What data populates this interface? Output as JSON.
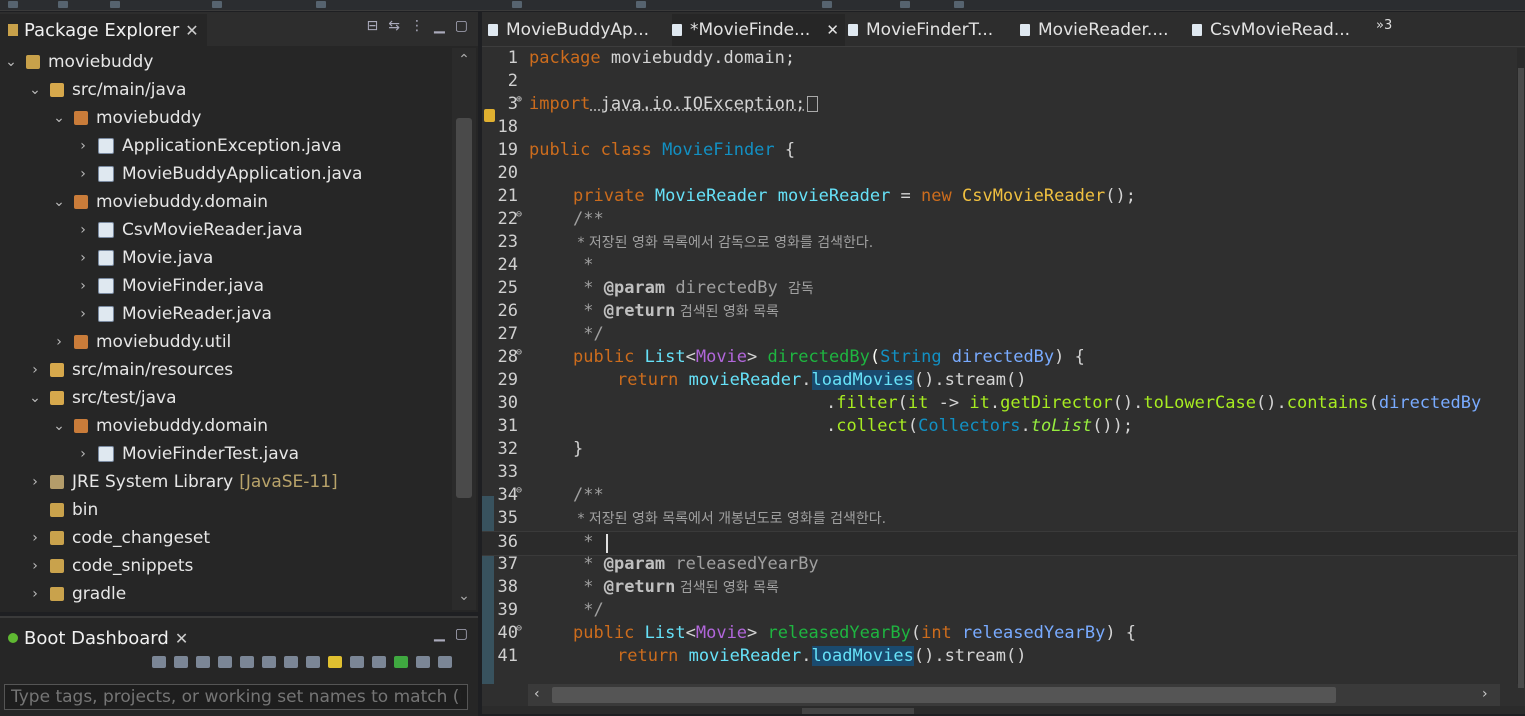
{
  "package_explorer": {
    "title": "Package Explorer",
    "close": "✕",
    "tree": [
      {
        "label": "moviebuddy",
        "depth": 0,
        "twisty": "⌄",
        "icon": "project-icon"
      },
      {
        "label": "src/main/java",
        "depth": 1,
        "twisty": "⌄",
        "icon": "source-folder-icon"
      },
      {
        "label": "moviebuddy",
        "depth": 2,
        "twisty": "⌄",
        "icon": "package-icon"
      },
      {
        "label": "ApplicationException.java",
        "depth": 3,
        "twisty": "›",
        "icon": "java-file-icon"
      },
      {
        "label": "MovieBuddyApplication.java",
        "depth": 3,
        "twisty": "›",
        "icon": "java-file-icon"
      },
      {
        "label": "moviebuddy.domain",
        "depth": 2,
        "twisty": "⌄",
        "icon": "package-icon"
      },
      {
        "label": "CsvMovieReader.java",
        "depth": 3,
        "twisty": "›",
        "icon": "java-file-icon"
      },
      {
        "label": "Movie.java",
        "depth": 3,
        "twisty": "›",
        "icon": "java-file-icon"
      },
      {
        "label": "MovieFinder.java",
        "depth": 3,
        "twisty": "›",
        "icon": "java-file-icon"
      },
      {
        "label": "MovieReader.java",
        "depth": 3,
        "twisty": "›",
        "icon": "java-file-icon"
      },
      {
        "label": "moviebuddy.util",
        "depth": 2,
        "twisty": "›",
        "icon": "package-icon"
      },
      {
        "label": "src/main/resources",
        "depth": 1,
        "twisty": "›",
        "icon": "source-folder-icon"
      },
      {
        "label": "src/test/java",
        "depth": 1,
        "twisty": "⌄",
        "icon": "source-folder-icon"
      },
      {
        "label": "moviebuddy.domain",
        "depth": 2,
        "twisty": "⌄",
        "icon": "package-icon"
      },
      {
        "label": "MovieFinderTest.java",
        "depth": 3,
        "twisty": "›",
        "icon": "java-file-icon"
      },
      {
        "label": "JRE System Library",
        "decoration": "[JavaSE-11]",
        "depth": 1,
        "twisty": "›",
        "icon": "jre-library-icon"
      },
      {
        "label": "bin",
        "depth": 1,
        "twisty": "",
        "icon": "folder-icon"
      },
      {
        "label": "code_changeset",
        "depth": 1,
        "twisty": "›",
        "icon": "folder-icon"
      },
      {
        "label": "code_snippets",
        "depth": 1,
        "twisty": "›",
        "icon": "folder-icon"
      },
      {
        "label": "gradle",
        "depth": 1,
        "twisty": "›",
        "icon": "folder-icon"
      }
    ]
  },
  "boot_dashboard": {
    "title": "Boot Dashboard",
    "close": "✕",
    "filter_placeholder": "Type tags, projects, or working set names to match (incl."
  },
  "editor": {
    "tabs": [
      {
        "label": "MovieBuddyAp...",
        "active": false
      },
      {
        "label": "*MovieFinde...",
        "active": true
      },
      {
        "label": "MovieFinderT...",
        "active": false
      },
      {
        "label": "MovieReader....",
        "active": false
      },
      {
        "label": "CsvMovieRead...",
        "active": false
      }
    ],
    "more_tabs": "»3",
    "tab_close": "✕",
    "lines": [
      {
        "n": "1",
        "fold": ""
      },
      {
        "n": "2",
        "fold": ""
      },
      {
        "n": "3",
        "fold": "⊕"
      },
      {
        "n": "18",
        "fold": ""
      },
      {
        "n": "19",
        "fold": ""
      },
      {
        "n": "20",
        "fold": ""
      },
      {
        "n": "21",
        "fold": ""
      },
      {
        "n": "22",
        "fold": "⊖"
      },
      {
        "n": "23",
        "fold": ""
      },
      {
        "n": "24",
        "fold": ""
      },
      {
        "n": "25",
        "fold": ""
      },
      {
        "n": "26",
        "fold": ""
      },
      {
        "n": "27",
        "fold": ""
      },
      {
        "n": "28",
        "fold": "⊖"
      },
      {
        "n": "29",
        "fold": ""
      },
      {
        "n": "30",
        "fold": ""
      },
      {
        "n": "31",
        "fold": ""
      },
      {
        "n": "32",
        "fold": ""
      },
      {
        "n": "33",
        "fold": ""
      },
      {
        "n": "34",
        "fold": "⊖"
      },
      {
        "n": "35",
        "fold": ""
      },
      {
        "n": "36",
        "fold": ""
      },
      {
        "n": "37",
        "fold": ""
      },
      {
        "n": "38",
        "fold": ""
      },
      {
        "n": "39",
        "fold": ""
      },
      {
        "n": "40",
        "fold": "⊖"
      },
      {
        "n": "41",
        "fold": ""
      }
    ],
    "code": {
      "l1_kw": "package",
      "l1_rest": " moviebuddy.domain;",
      "l3_kw": "import",
      "l3_rest": " java.io.IOException;",
      "l19_kw": "public class ",
      "l19_cls": "MovieFinder",
      "l19_rest": " {",
      "l21_kw": "private ",
      "l21_ty": "MovieReader",
      "l21_fld": " movieReader",
      "l21_eq": " = ",
      "l21_new": "new ",
      "l21_cls": "CsvMovieReader",
      "l21_end": "();",
      "l22": "/**",
      "l23": " * 저장된 영화 목록에서 감독으로 영화를 검색한다.",
      "l24": " *",
      "l25_a": " * ",
      "l25_tag": "@param",
      "l25_b": " directedBy ",
      "l25_k": "감독",
      "l26_a": " * ",
      "l26_tag": "@return",
      "l26_k": " 검색된 영화 목록",
      "l27": " */",
      "l28_kw": "public ",
      "l28_ty": "List",
      "l28_lt": "<",
      "l28_g": "Movie",
      "l28_gt": "> ",
      "l28_mt": "directedBy",
      "l28_p1": "(",
      "l28_pty": "String",
      "l28_pn": " directedBy",
      "l28_end": ") {",
      "l29_kw": "return ",
      "l29_f": "movieReader",
      "l29_dot": ".",
      "l29_m": "loadMovies",
      "l29_rest": "().stream()",
      "l30_a": ".",
      "l30_m1": "filter",
      "l30_b": "(",
      "l30_it": "it",
      "l30_ar": " -> ",
      "l30_it2": "it",
      "l30_d": ".",
      "l30_m2": "getDirector",
      "l30_c": "().",
      "l30_m3": "toLowerCase",
      "l30_e": "().",
      "l30_m4": "contains",
      "l30_f": "(",
      "l30_p": "directedBy",
      "l31_a": ".",
      "l31_m": "collect",
      "l31_b": "(",
      "l31_c": "Collectors",
      "l31_d": ".",
      "l31_s": "toList",
      "l31_e": "());",
      "l32": "}",
      "l34": "/**",
      "l35": " * 저장된 영화 목록에서 개봉년도로 영화를 검색한다.",
      "l36": " * ",
      "l37_a": " * ",
      "l37_tag": "@param",
      "l37_b": " releasedYearBy",
      "l38_a": " * ",
      "l38_tag": "@return",
      "l38_k": " 검색된 영화 목록",
      "l39": " */",
      "l40_kw": "public ",
      "l40_ty": "List",
      "l40_lt": "<",
      "l40_g": "Movie",
      "l40_gt": "> ",
      "l40_mt": "releasedYearBy",
      "l40_p1": "(",
      "l40_pty": "int",
      "l40_pn": " releasedYearBy",
      "l40_end": ") {",
      "l41_kw": "return ",
      "l41_f": "movieReader",
      "l41_dot": ".",
      "l41_m": "loadMovies",
      "l41_rest": "().stream()"
    }
  }
}
